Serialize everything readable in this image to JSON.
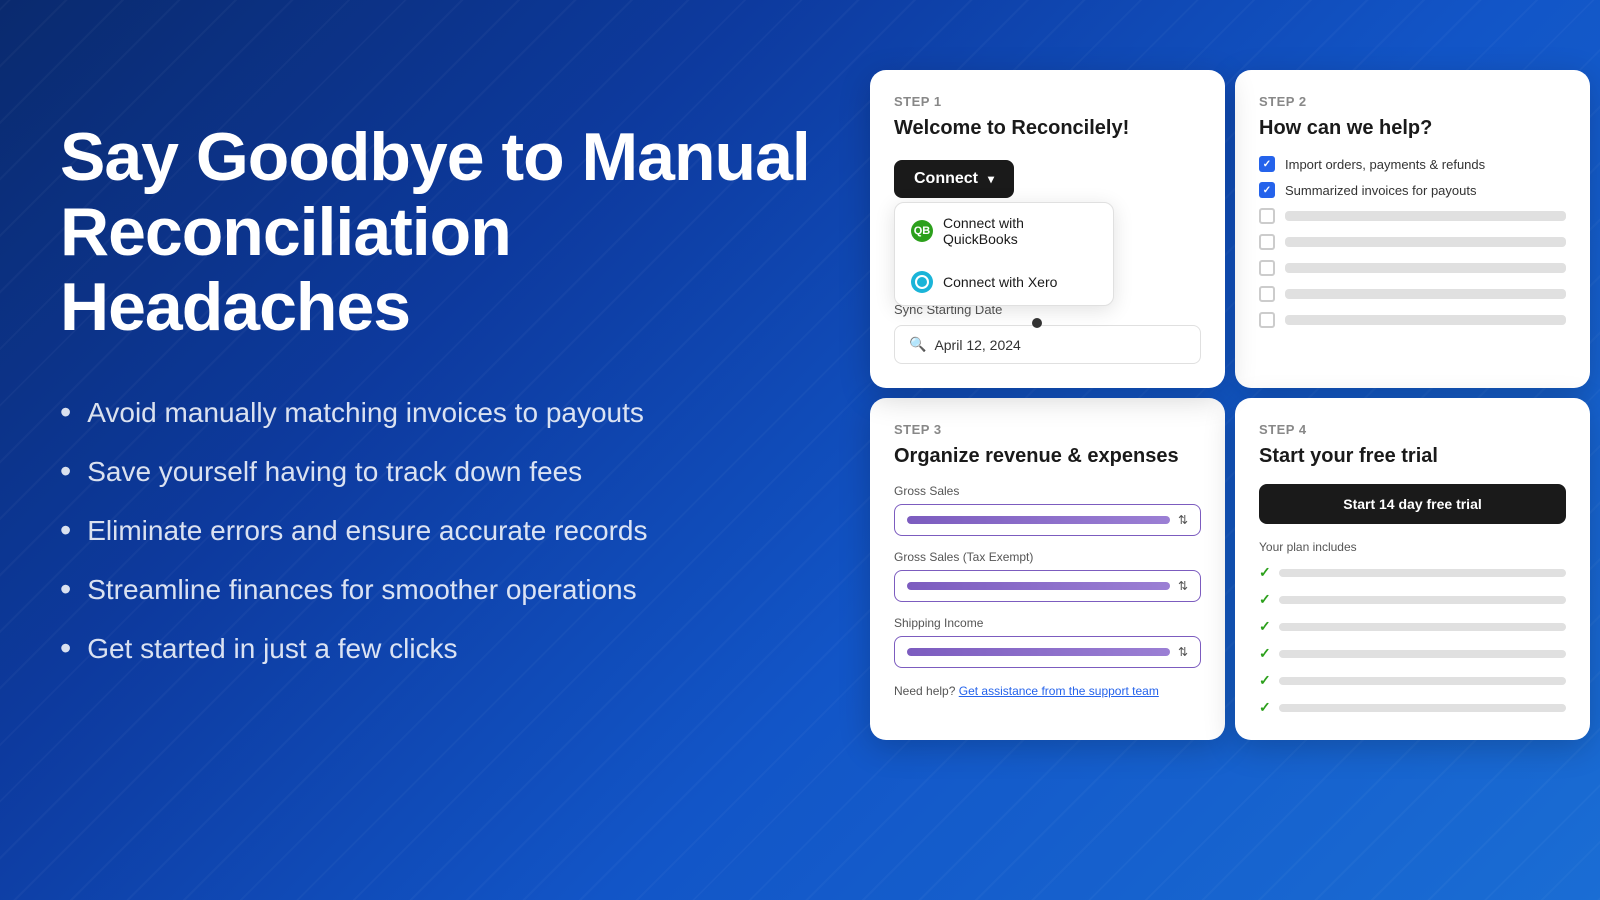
{
  "background": {
    "color_start": "#0a2a6e",
    "color_end": "#1a6dd4"
  },
  "left": {
    "heading": "Say Goodbye to Manual Reconciliation Headaches",
    "bullets": [
      "Avoid manually matching invoices to payouts",
      "Save yourself having to track down fees",
      "Eliminate errors and ensure accurate records",
      "Streamline finances for smoother operations",
      "Get started in just a few clicks"
    ]
  },
  "step1": {
    "step_label": "STEP 1",
    "title": "Welcome to Reconcilely!",
    "connect_btn": "Connect",
    "dropdown": [
      {
        "label": "Connect with QuickBooks",
        "icon": "quickbooks"
      },
      {
        "label": "Connect with Xero",
        "icon": "xero"
      }
    ],
    "sync_label": "Sync Starting Date",
    "sync_date": "April 12, 2024"
  },
  "step2": {
    "step_label": "STEP 2",
    "title": "How can we help?",
    "items": [
      {
        "checked": true,
        "text": "Import orders, payments & refunds"
      },
      {
        "checked": true,
        "text": "Summarized invoices for payouts"
      },
      {
        "checked": false,
        "text": ""
      },
      {
        "checked": false,
        "text": ""
      },
      {
        "checked": false,
        "text": ""
      },
      {
        "checked": false,
        "text": ""
      },
      {
        "checked": false,
        "text": ""
      }
    ]
  },
  "step3": {
    "step_label": "STEP 3",
    "title": "Organize revenue & expenses",
    "fields": [
      {
        "label": "Gross Sales"
      },
      {
        "label": "Gross Sales (Tax Exempt)"
      },
      {
        "label": "Shipping Income"
      }
    ],
    "help_prefix": "Need help?",
    "help_link": "Get assistance from the support team"
  },
  "step4": {
    "step_label": "STEP 4",
    "title": "Start your free trial",
    "cta_btn": "Start 14 day free trial",
    "plan_label": "Your plan includes",
    "plan_items": [
      "",
      "",
      "",
      "",
      "",
      ""
    ]
  }
}
